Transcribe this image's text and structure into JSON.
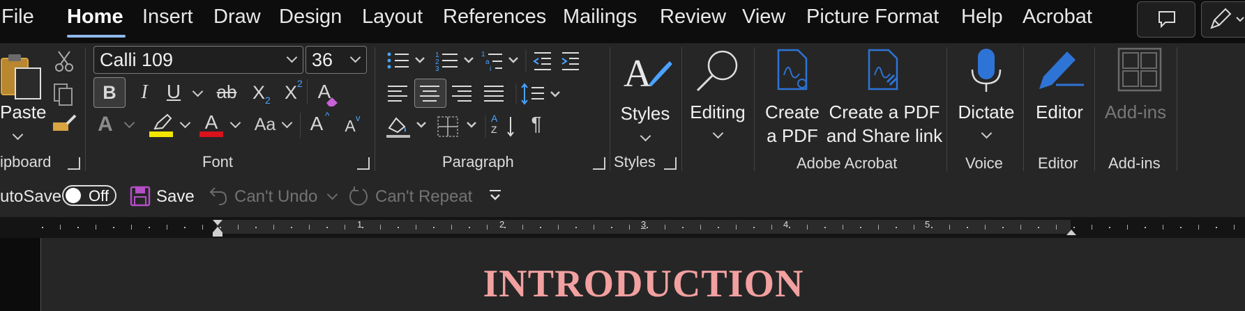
{
  "tabs": [
    {
      "label": "File"
    },
    {
      "label": "Home"
    },
    {
      "label": "Insert"
    },
    {
      "label": "Draw"
    },
    {
      "label": "Design"
    },
    {
      "label": "Layout"
    },
    {
      "label": "References"
    },
    {
      "label": "Mailings"
    },
    {
      "label": "Review"
    },
    {
      "label": "View"
    },
    {
      "label": "Picture Format"
    },
    {
      "label": "Help"
    },
    {
      "label": "Acrobat"
    }
  ],
  "active_tab": "Home",
  "clipboard": {
    "paste_label": "Paste",
    "group_label": "ipboard"
  },
  "font": {
    "family": "Calli 109",
    "size": "36",
    "group_label": "Font",
    "bold": "B",
    "italic": "I",
    "underline": "U",
    "strike": "ab",
    "subscript": "X",
    "superscript": "X",
    "sub_mark": "2",
    "sup_mark": "2",
    "text_effects": "A",
    "highlight": "A",
    "font_color": "A",
    "change_case": "Aa",
    "grow": "A",
    "shrink": "A",
    "clear": "A",
    "highlight_color": "#f2e600",
    "font_color_bar": "#d9121c"
  },
  "paragraph": {
    "group_label": "Paragraph",
    "sort_a": "A",
    "sort_z": "Z",
    "pilcrow": "¶"
  },
  "styles": {
    "label": "Styles",
    "group_label": "Styles"
  },
  "editing": {
    "label": "Editing"
  },
  "acrobat": {
    "create_pdf_line1": "Create",
    "create_pdf_line2": "a PDF",
    "share_line1": "Create a PDF",
    "share_line2": "and Share link",
    "group_label": "Adobe Acrobat"
  },
  "voice": {
    "label": "Dictate",
    "group_label": "Voice"
  },
  "editor": {
    "label": "Editor",
    "group_label": "Editor"
  },
  "addins": {
    "label": "Add-ins",
    "group_label": "Add-ins"
  },
  "qat": {
    "autosave_label": "utoSave",
    "toggle_state": "Off",
    "save_label": "Save",
    "undo_label": "Can't Undo",
    "repeat_label": "Can't Repeat"
  },
  "ruler": {
    "numbers": [
      "1",
      "2",
      "3",
      "4",
      "5"
    ]
  },
  "document": {
    "heading": "INTRODUCTION"
  },
  "colors": {
    "accent": "#8fb8ea",
    "acrobat_blue": "#2e74d6",
    "heading": "#f2a0a0",
    "save_icon": "#b44fc8"
  }
}
